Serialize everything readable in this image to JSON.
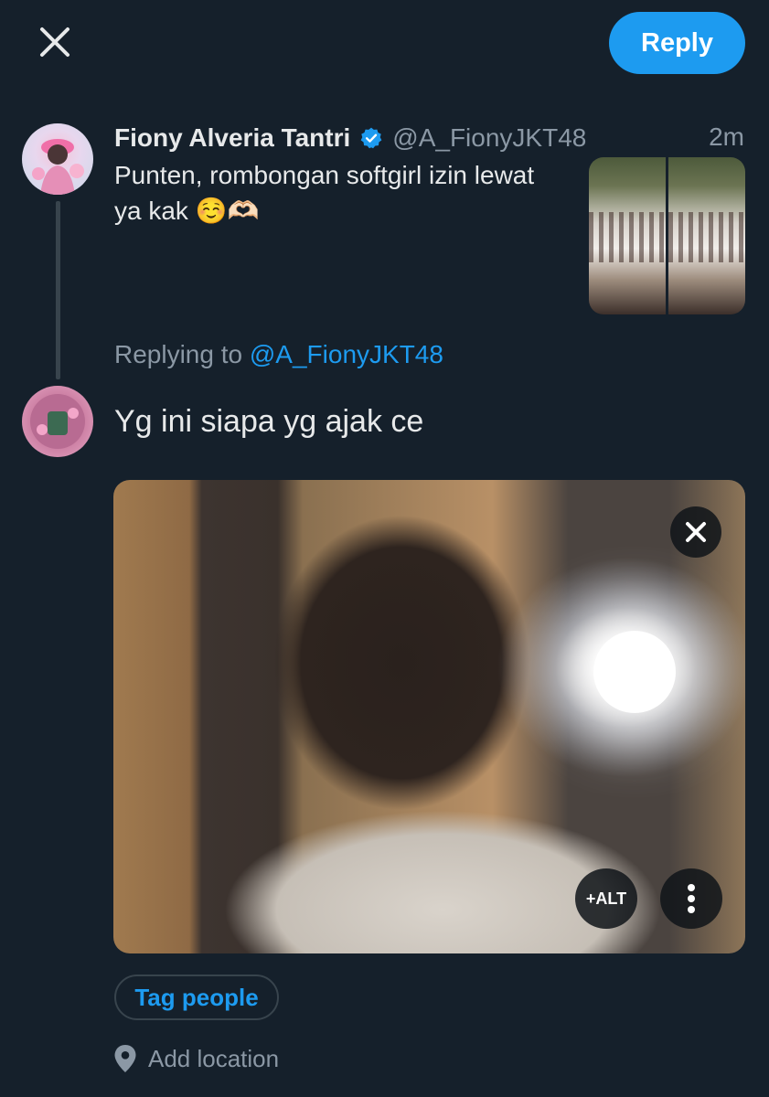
{
  "header": {
    "close_icon": "close-icon",
    "reply_label": "Reply",
    "accent_color": "#1d9bf0"
  },
  "original_tweet": {
    "author_name": "Fiony Alveria Tantri",
    "verified_icon": "verified-badge-icon",
    "handle": "@A_FionyJKT48",
    "time": "2m",
    "text_line1": "Punten, rombongan softgirl izin lewat",
    "text_line2": "ya kak ☺️🫶🏻"
  },
  "compose": {
    "replying_prefix": "Replying to",
    "replying_handle": "@A_FionyJKT48",
    "text": "Yg ini siapa yg ajak ce",
    "media": {
      "close_icon": "close-icon",
      "alt_label": "+ALT",
      "more_icon": "more-vertical-icon"
    },
    "tag_people_label": "Tag people",
    "location_icon": "location-pin-icon",
    "add_location_label": "Add location"
  }
}
